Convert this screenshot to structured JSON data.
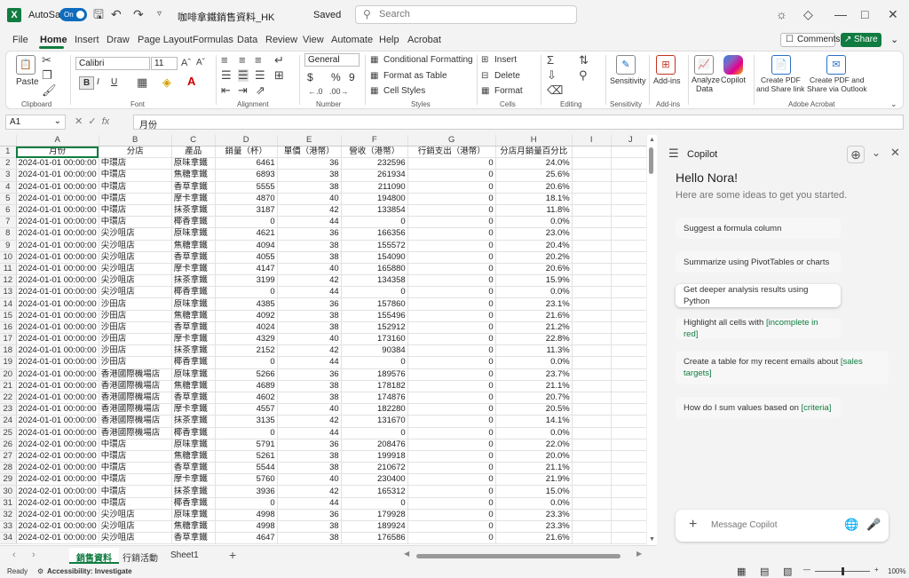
{
  "titlebar": {
    "autosave_label": "AutoSave",
    "autosave_state": "On",
    "filename": "咖啡拿鐵銷售資料_HK",
    "save_status": "Saved",
    "search_placeholder": "Search"
  },
  "menu": {
    "items": [
      "File",
      "Home",
      "Insert",
      "Draw",
      "Page Layout",
      "Formulas",
      "Data",
      "Review",
      "View",
      "Automate",
      "Help",
      "Acrobat"
    ],
    "active": "Home",
    "comments_label": "Comments",
    "share_label": "Share"
  },
  "ribbon": {
    "clipboard": {
      "paste_label": "Paste",
      "group_label": "Clipboard"
    },
    "font": {
      "family": "Calibri",
      "size": "11",
      "group_label": "Font",
      "bold": "B",
      "italic": "I",
      "underline": "U"
    },
    "alignment": {
      "group_label": "Alignment"
    },
    "number": {
      "format": "General",
      "group_label": "Number",
      "currency": "$",
      "percent": "%",
      "comma": "9"
    },
    "styles": {
      "conditional": "Conditional Formatting",
      "format_table": "Format as Table",
      "cell_styles": "Cell Styles",
      "group_label": "Styles"
    },
    "cells": {
      "insert": "Insert",
      "delete": "Delete",
      "format": "Format",
      "group_label": "Cells"
    },
    "editing": {
      "group_label": "Editing"
    },
    "sensitivity": {
      "label": "Sensitivity",
      "group_label": "Sensitivity"
    },
    "addins": {
      "label": "Add-ins",
      "group_label": "Add-ins"
    },
    "analyze": {
      "label_line1": "Analyze",
      "label_line2": "Data"
    },
    "copilot": {
      "label": "Copilot"
    },
    "acrobat": {
      "pdf_share_line1": "Create PDF",
      "pdf_share_line2": "and Share link",
      "pdf_outlook_line1": "Create PDF and",
      "pdf_outlook_line2": "Share via Outlook",
      "group_label": "Adobe Acrobat"
    }
  },
  "formula_bar": {
    "name_box": "A1",
    "fx": "fx",
    "formula": "月份"
  },
  "grid": {
    "columns": [
      "A",
      "B",
      "C",
      "D",
      "E",
      "F",
      "G",
      "H",
      "I",
      "J"
    ],
    "headers": [
      "月份",
      "分店",
      "產品",
      "銷量（杯）",
      "單價（港幣）",
      "營收（港幣）",
      "行銷支出（港幣）",
      "分店月銷量百分比"
    ],
    "rows": [
      [
        "2024-01-01 00:00:00",
        "中環店",
        "原味拿鐵",
        "6461",
        "36",
        "232596",
        "0",
        "24.0%"
      ],
      [
        "2024-01-01 00:00:00",
        "中環店",
        "焦糖拿鐵",
        "6893",
        "38",
        "261934",
        "0",
        "25.6%"
      ],
      [
        "2024-01-01 00:00:00",
        "中環店",
        "香草拿鐵",
        "5555",
        "38",
        "211090",
        "0",
        "20.6%"
      ],
      [
        "2024-01-01 00:00:00",
        "中環店",
        "摩卡拿鐵",
        "4870",
        "40",
        "194800",
        "0",
        "18.1%"
      ],
      [
        "2024-01-01 00:00:00",
        "中環店",
        "抹茶拿鐵",
        "3187",
        "42",
        "133854",
        "0",
        "11.8%"
      ],
      [
        "2024-01-01 00:00:00",
        "中環店",
        "椰香拿鐵",
        "0",
        "44",
        "0",
        "0",
        "0.0%"
      ],
      [
        "2024-01-01 00:00:00",
        "尖沙咀店",
        "原味拿鐵",
        "4621",
        "36",
        "166356",
        "0",
        "23.0%"
      ],
      [
        "2024-01-01 00:00:00",
        "尖沙咀店",
        "焦糖拿鐵",
        "4094",
        "38",
        "155572",
        "0",
        "20.4%"
      ],
      [
        "2024-01-01 00:00:00",
        "尖沙咀店",
        "香草拿鐵",
        "4055",
        "38",
        "154090",
        "0",
        "20.2%"
      ],
      [
        "2024-01-01 00:00:00",
        "尖沙咀店",
        "摩卡拿鐵",
        "4147",
        "40",
        "165880",
        "0",
        "20.6%"
      ],
      [
        "2024-01-01 00:00:00",
        "尖沙咀店",
        "抹茶拿鐵",
        "3199",
        "42",
        "134358",
        "0",
        "15.9%"
      ],
      [
        "2024-01-01 00:00:00",
        "尖沙咀店",
        "椰香拿鐵",
        "0",
        "44",
        "0",
        "0",
        "0.0%"
      ],
      [
        "2024-01-01 00:00:00",
        "沙田店",
        "原味拿鐵",
        "4385",
        "36",
        "157860",
        "0",
        "23.1%"
      ],
      [
        "2024-01-01 00:00:00",
        "沙田店",
        "焦糖拿鐵",
        "4092",
        "38",
        "155496",
        "0",
        "21.6%"
      ],
      [
        "2024-01-01 00:00:00",
        "沙田店",
        "香草拿鐵",
        "4024",
        "38",
        "152912",
        "0",
        "21.2%"
      ],
      [
        "2024-01-01 00:00:00",
        "沙田店",
        "摩卡拿鐵",
        "4329",
        "40",
        "173160",
        "0",
        "22.8%"
      ],
      [
        "2024-01-01 00:00:00",
        "沙田店",
        "抹茶拿鐵",
        "2152",
        "42",
        "90384",
        "0",
        "11.3%"
      ],
      [
        "2024-01-01 00:00:00",
        "沙田店",
        "椰香拿鐵",
        "0",
        "44",
        "0",
        "0",
        "0.0%"
      ],
      [
        "2024-01-01 00:00:00",
        "香港國際機場店",
        "原味拿鐵",
        "5266",
        "36",
        "189576",
        "0",
        "23.7%"
      ],
      [
        "2024-01-01 00:00:00",
        "香港國際機場店",
        "焦糖拿鐵",
        "4689",
        "38",
        "178182",
        "0",
        "21.1%"
      ],
      [
        "2024-01-01 00:00:00",
        "香港國際機場店",
        "香草拿鐵",
        "4602",
        "38",
        "174876",
        "0",
        "20.7%"
      ],
      [
        "2024-01-01 00:00:00",
        "香港國際機場店",
        "摩卡拿鐵",
        "4557",
        "40",
        "182280",
        "0",
        "20.5%"
      ],
      [
        "2024-01-01 00:00:00",
        "香港國際機場店",
        "抹茶拿鐵",
        "3135",
        "42",
        "131670",
        "0",
        "14.1%"
      ],
      [
        "2024-01-01 00:00:00",
        "香港國際機場店",
        "椰香拿鐵",
        "0",
        "44",
        "0",
        "0",
        "0.0%"
      ],
      [
        "2024-02-01 00:00:00",
        "中環店",
        "原味拿鐵",
        "5791",
        "36",
        "208476",
        "0",
        "22.0%"
      ],
      [
        "2024-02-01 00:00:00",
        "中環店",
        "焦糖拿鐵",
        "5261",
        "38",
        "199918",
        "0",
        "20.0%"
      ],
      [
        "2024-02-01 00:00:00",
        "中環店",
        "香草拿鐵",
        "5544",
        "38",
        "210672",
        "0",
        "21.1%"
      ],
      [
        "2024-02-01 00:00:00",
        "中環店",
        "摩卡拿鐵",
        "5760",
        "40",
        "230400",
        "0",
        "21.9%"
      ],
      [
        "2024-02-01 00:00:00",
        "中環店",
        "抹茶拿鐵",
        "3936",
        "42",
        "165312",
        "0",
        "15.0%"
      ],
      [
        "2024-02-01 00:00:00",
        "中環店",
        "椰香拿鐵",
        "0",
        "44",
        "0",
        "0",
        "0.0%"
      ],
      [
        "2024-02-01 00:00:00",
        "尖沙咀店",
        "原味拿鐵",
        "4998",
        "36",
        "179928",
        "0",
        "23.3%"
      ],
      [
        "2024-02-01 00:00:00",
        "尖沙咀店",
        "焦糖拿鐵",
        "4998",
        "38",
        "189924",
        "0",
        "23.3%"
      ],
      [
        "2024-02-01 00:00:00",
        "尖沙咀店",
        "香草拿鐵",
        "4647",
        "38",
        "176586",
        "0",
        "21.6%"
      ]
    ]
  },
  "sheets": {
    "tabs": [
      "銷售資料",
      "行銷活動",
      "Sheet1"
    ],
    "active": "銷售資料"
  },
  "status": {
    "ready": "Ready",
    "accessibility": "Accessibility: Investigate",
    "zoom": "100%"
  },
  "copilot": {
    "title": "Copilot",
    "greeting": "Hello Nora!",
    "subtitle": "Here are some ideas to get you started.",
    "suggestions": [
      {
        "text": "Suggest a formula column",
        "tag": ""
      },
      {
        "text": "Summarize using PivotTables or charts",
        "tag": ""
      },
      {
        "text": "Get deeper analysis results using Python",
        "tag": ""
      },
      {
        "text": "Highlight all cells with ",
        "tag": "[incomplete in red]"
      },
      {
        "text": "Create a table for my recent emails about ",
        "tag": "[sales targets]"
      },
      {
        "text": "How do I sum values based on ",
        "tag": "[criteria]"
      }
    ],
    "input_placeholder": "Message Copilot"
  }
}
